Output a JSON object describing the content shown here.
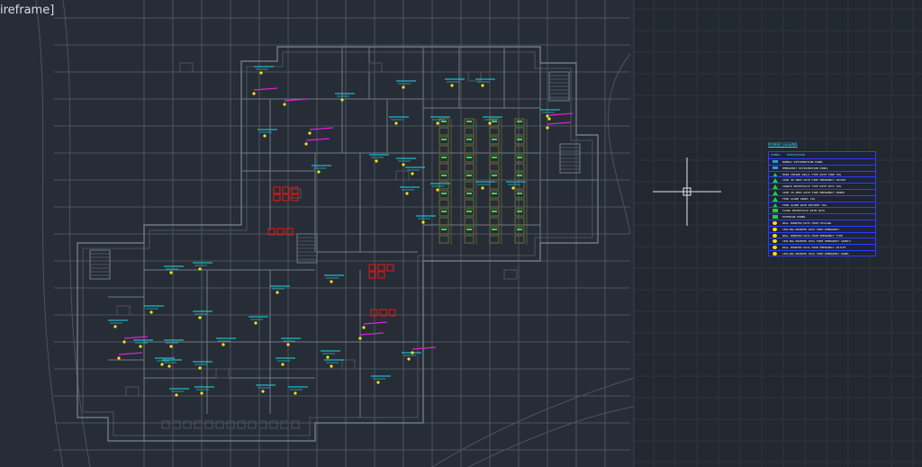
{
  "viewport": {
    "label": "ireframe]"
  },
  "colors": {
    "background": "#212830",
    "grid": "#2a333d",
    "wall": "#6f7a86",
    "wall_dim": "#4a5360",
    "tag_cyan": "#22d7ea",
    "tag_magenta": "#e020d8",
    "device_yellow": "#f5e21a",
    "panel_red": "#d01818",
    "legend_border": "#2c3cff",
    "legend_green": "#1fcc4a",
    "legend_title": "#2fe0f0"
  },
  "legend": {
    "title": "POWER LEGEND",
    "header": [
      "SYMBOL",
      "DESCRIPTION"
    ],
    "rows": [
      {
        "symbol": "panel-icon",
        "text": "NORMAL DISTRIBUTION PANEL"
      },
      {
        "symbol": "panel-icon",
        "text": "EMERGENCY DISTRIBUTION PANEL"
      },
      {
        "symbol": "triangle-icon",
        "text": "MAIN INTAKE 20A/1 TYPE WITH FIRE TAG"
      },
      {
        "symbol": "triangle-icon",
        "text": "SIDE 20 AMPS WITH FIRE EMERGENCY SOCKET"
      },
      {
        "symbol": "triangle-icon",
        "text": "SINGLE RECEPTACLE TYPE WITH GFCI TAG"
      },
      {
        "symbol": "triangle-icon",
        "text": "SIDE 20 AMPS WITH FIRE EMERGENCY POWER"
      },
      {
        "symbol": "triangle-icon",
        "text": "FIRE ALARM PANEL TAG"
      },
      {
        "symbol": "triangle-icon",
        "text": "FIRE ALARM WITH BATTERY TAG"
      },
      {
        "symbol": "rect-icon",
        "text": "FLOOR RECEPTACLE WITH DATA"
      },
      {
        "symbol": "rect-icon",
        "text": "EXTERIOR POWER"
      },
      {
        "symbol": "circle-icon",
        "text": "WALL MOUNTED DATA FROM CEILING"
      },
      {
        "symbol": "circle-icon",
        "text": "CEILING MOUNTED DATA FROM EMERGENCY"
      },
      {
        "symbol": "circle-icon",
        "text": "WALL MOUNTED DATA FROM EMERGENCY TYPE"
      },
      {
        "symbol": "circle-icon",
        "text": "CEILING MOUNTED DATA FROM EMERGENCY SUPPLY"
      },
      {
        "symbol": "circle-icon",
        "text": "WALL MOUNTED DATA FROM EMERGENCY OUTLET"
      },
      {
        "symbol": "circle-icon",
        "text": "CEILING MOUNTED DATA FROM EMERGENCY PANEL"
      }
    ]
  }
}
